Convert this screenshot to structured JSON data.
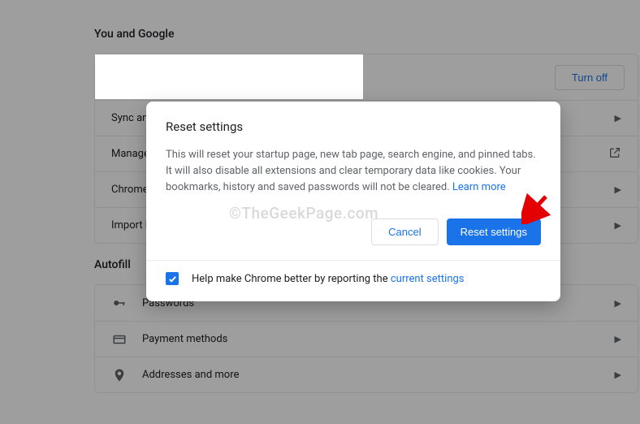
{
  "sections": {
    "you_and_google": {
      "title": "You and Google",
      "turn_off": "Turn off",
      "rows": {
        "sync": "Sync and Google services",
        "manage": "Manage your Google Account",
        "chrome_name": "Chrome name and picture",
        "import": "Import bookmarks and settings"
      }
    },
    "autofill": {
      "title": "Autofill",
      "rows": {
        "passwords": "Passwords",
        "payment": "Payment methods",
        "addresses": "Addresses and more"
      }
    }
  },
  "dialog": {
    "title": "Reset settings",
    "body": "This will reset your startup page, new tab page, search engine, and pinned tabs. It will also disable all extensions and clear temporary data like cookies. Your bookmarks, history and saved passwords will not be cleared. ",
    "learn_more": "Learn more",
    "cancel": "Cancel",
    "confirm": "Reset settings",
    "footer_prefix": "Help make Chrome better by reporting the ",
    "footer_link": "current settings"
  },
  "watermark": "©TheGeekPage.com"
}
